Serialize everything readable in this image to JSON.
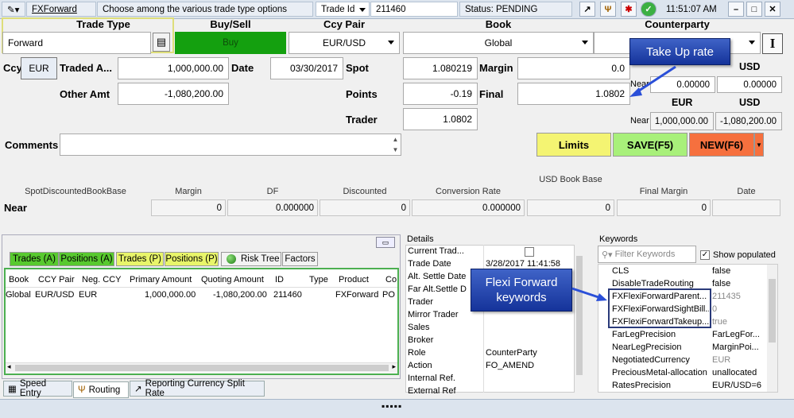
{
  "topbar": {
    "title_link": "FXForward",
    "hint": "Choose among the various trade type options",
    "trade_id_label": "Trade Id",
    "trade_id_value": "211460",
    "status": "Status: PENDING",
    "time": "11:51:07 AM"
  },
  "headers": {
    "trade_type": "Trade Type",
    "buy_sell": "Buy/Sell",
    "ccy_pair": "Ccy Pair",
    "book": "Book",
    "counterparty": "Counterparty"
  },
  "row1": {
    "trade_type": "Forward",
    "buy_sell": "Buy",
    "ccy_pair": "EUR/USD",
    "book": "Global"
  },
  "labels": {
    "ccy": "Ccy",
    "traded_amt": "Traded A...",
    "date": "Date",
    "spot": "Spot",
    "margin": "Margin",
    "other_amt": "Other Amt",
    "points": "Points",
    "final": "Final",
    "trader": "Trader",
    "comments": "Comments"
  },
  "values": {
    "ccy": "EUR",
    "traded_amt": "1,000,000.00",
    "date": "03/30/2017",
    "spot": "1.080219",
    "margin": "0.0",
    "other_amt": "-1,080,200.00",
    "points": "-0.19",
    "final": "1.0802",
    "trader": "1.0802"
  },
  "near_panel": {
    "usd_top": "USD",
    "near1": "Near",
    "near1_a": "0.00000",
    "near1_b": "0.00000",
    "eur": "EUR",
    "usd": "USD",
    "near2": "Near",
    "near2_a": "1,000,000.00",
    "near2_b": "-1,080,200.00"
  },
  "buttons": {
    "limits": "Limits",
    "save": "SAVE(F5)",
    "new": "NEW(F6)"
  },
  "callouts": {
    "take_up": "Take Up rate",
    "flexi": "Flexi Forward keywords"
  },
  "summary": {
    "cols": [
      "SpotDiscountedBookBase",
      "Margin",
      "DF",
      "Discounted",
      "Conversion Rate",
      "USD Book Base",
      "Final Margin",
      "Date"
    ],
    "row_label": "Near",
    "vals": [
      "0",
      "0.000000",
      "0",
      "0.000000",
      "0",
      "0",
      ""
    ]
  },
  "tabs": [
    "Trades (A)",
    "Positions (A)",
    "Trades (P)",
    "Positions (P)",
    "Risk Tree",
    "Factors"
  ],
  "grid": {
    "headers": [
      "Book",
      "CCY Pair",
      "Neg. CCY",
      "Primary Amount",
      "Quoting Amount",
      "ID",
      "Type",
      "Product",
      "Co"
    ],
    "row": [
      "Global",
      "EUR/USD",
      "EUR",
      "1,000,000.00",
      "-1,080,200.00",
      "211460",
      "",
      "FXForward",
      "PO"
    ]
  },
  "details": {
    "title": "Details",
    "rows": [
      [
        "Current Trad...",
        ""
      ],
      [
        "Trade Date",
        "3/28/2017 11:41:58"
      ],
      [
        "Alt. Settle Date",
        ""
      ],
      [
        "Far Alt.Settle D",
        ""
      ],
      [
        "Trader",
        ""
      ],
      [
        "Mirror Trader",
        ""
      ],
      [
        "Sales",
        ""
      ],
      [
        "Broker",
        ""
      ],
      [
        "Role",
        "CounterParty"
      ],
      [
        "Action",
        "FO_AMEND"
      ],
      [
        "Internal Ref.",
        ""
      ],
      [
        "External Ref",
        ""
      ]
    ]
  },
  "keywords": {
    "title": "Keywords",
    "filter_placeholder": "Filter Keywords",
    "show_populated": "Show populated",
    "rows": [
      [
        "CLS",
        "false"
      ],
      [
        "DisableTradeRouting",
        "false"
      ],
      [
        "FXFlexiForwardParent...",
        "211435"
      ],
      [
        "FXFlexiForwardSightBill...",
        "0"
      ],
      [
        "FXFlexiForwardTakeup...",
        "true"
      ],
      [
        "FarLegPrecision",
        "FarLegFor..."
      ],
      [
        "NearLegPrecision",
        "MarginPoi..."
      ],
      [
        "NegotiatedCurrency",
        "EUR"
      ],
      [
        "PreciousMetal-allocation",
        "unallocated"
      ],
      [
        "RatesPrecision",
        "EUR/USD=6"
      ]
    ]
  },
  "bottom_tabs": [
    "Speed Entry",
    "Routing",
    "Reporting Currency Split Rate"
  ],
  "colors": {
    "buy": "#14a00f",
    "limits": "#f4f472",
    "save": "#a8f07a",
    "new": "#f6703e",
    "tab_yellow": "#e8f56a",
    "tab_green": "#58c92f"
  }
}
